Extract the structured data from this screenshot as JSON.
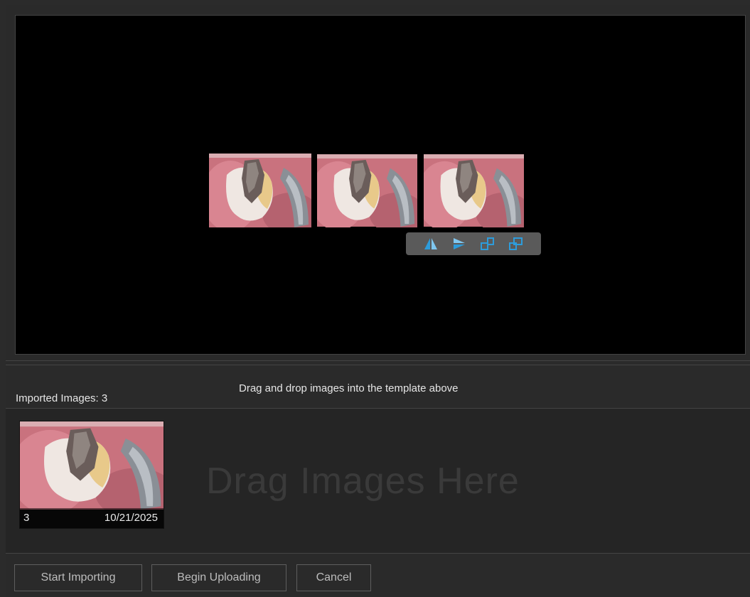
{
  "template": {
    "slots": [
      {
        "name": "slot-1"
      },
      {
        "name": "slot-2"
      },
      {
        "name": "slot-3"
      }
    ],
    "toolbar": {
      "icons": [
        "flip-horizontal-icon",
        "flip-vertical-icon",
        "rotate-left-icon",
        "rotate-right-icon"
      ],
      "accent_color": "#2d9cdb"
    }
  },
  "status": {
    "imported_label": "Imported Images: 3",
    "hint": "Drag and drop images into the template above"
  },
  "drop_zone": {
    "placeholder": "Drag Images Here",
    "thumbnails": [
      {
        "index": "3",
        "date": "10/21/2025"
      }
    ]
  },
  "buttons": {
    "start_importing": "Start Importing",
    "begin_uploading": "Begin Uploading",
    "cancel": "Cancel"
  },
  "colors": {
    "background": "#2a2a2a",
    "viewport": "#000000",
    "button_border": "#5e5e5e"
  }
}
